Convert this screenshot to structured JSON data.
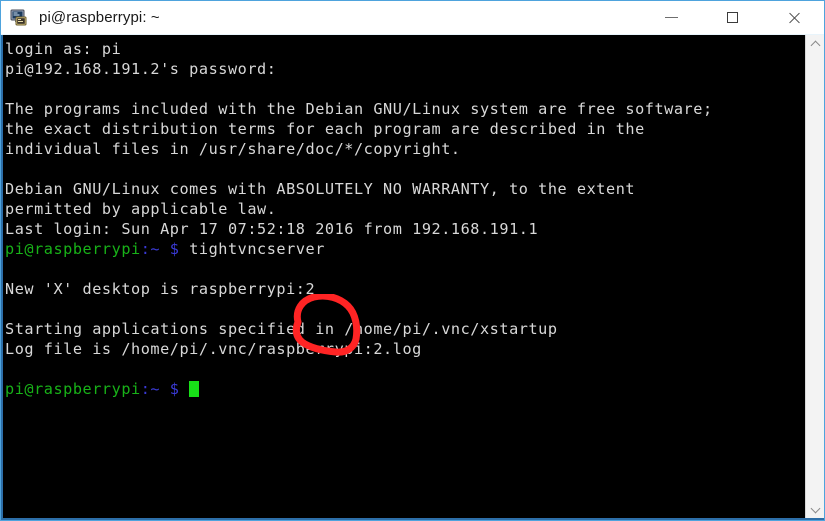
{
  "window": {
    "title": "pi@raspberrypi: ~",
    "icon": "putty-terminal-icon",
    "border_color": "#2c6ea8",
    "titlebar_bg": "#ffffff",
    "controls": {
      "minimize_label": "Minimize",
      "maximize_label": "Maximize",
      "close_label": "Close"
    }
  },
  "terminal": {
    "background": "#000000",
    "foreground": "#d8d8d8",
    "prompt_user_color": "#18b218",
    "prompt_path_color": "#3a3ad6",
    "cursor_color": "#18e018",
    "font_size_px": 15,
    "lines": [
      {
        "segments": [
          {
            "text": "login as: pi",
            "color": "white"
          }
        ]
      },
      {
        "segments": [
          {
            "text": "pi@192.168.191.2's password:",
            "color": "white"
          }
        ]
      },
      {
        "segments": [
          {
            "text": "",
            "color": "white"
          }
        ]
      },
      {
        "segments": [
          {
            "text": "The programs included with the Debian GNU/Linux system are free software;",
            "color": "white"
          }
        ]
      },
      {
        "segments": [
          {
            "text": "the exact distribution terms for each program are described in the",
            "color": "white"
          }
        ]
      },
      {
        "segments": [
          {
            "text": "individual files in /usr/share/doc/*/copyright.",
            "color": "white"
          }
        ]
      },
      {
        "segments": [
          {
            "text": "",
            "color": "white"
          }
        ]
      },
      {
        "segments": [
          {
            "text": "Debian GNU/Linux comes with ABSOLUTELY NO WARRANTY, to the extent",
            "color": "white"
          }
        ]
      },
      {
        "segments": [
          {
            "text": "permitted by applicable law.",
            "color": "white"
          }
        ]
      },
      {
        "segments": [
          {
            "text": "Last login: Sun Apr 17 07:52:18 2016 from 192.168.191.1",
            "color": "white"
          }
        ]
      },
      {
        "segments": [
          {
            "text": "pi@raspberrypi",
            "color": "green"
          },
          {
            "text": ":~ $ ",
            "color": "blue"
          },
          {
            "text": "tightvncserver",
            "color": "white"
          }
        ]
      },
      {
        "segments": [
          {
            "text": "",
            "color": "white"
          }
        ]
      },
      {
        "segments": [
          {
            "text": "New 'X' desktop is raspberrypi:2",
            "color": "white"
          }
        ]
      },
      {
        "segments": [
          {
            "text": "",
            "color": "white"
          }
        ]
      },
      {
        "segments": [
          {
            "text": "Starting applications specified in /home/pi/.vnc/xstartup",
            "color": "white"
          }
        ]
      },
      {
        "segments": [
          {
            "text": "Log file is /home/pi/.vnc/raspberrypi:2.log",
            "color": "white"
          }
        ]
      },
      {
        "segments": [
          {
            "text": "",
            "color": "white"
          }
        ]
      },
      {
        "segments": [
          {
            "text": "pi@raspberrypi",
            "color": "green"
          },
          {
            "text": ":~ $ ",
            "color": "blue"
          },
          {
            "text": "",
            "color": "white",
            "cursor": true
          }
        ]
      }
    ]
  },
  "annotation": {
    "kind": "hand-drawn-red-circle",
    "color": "#ff2424",
    "highlights_text": ":2",
    "on_line": "New 'X' desktop is raspberrypi:2"
  },
  "scrollbar": {
    "up_arrow_label": "Scroll up",
    "down_arrow_label": "Scroll down",
    "track_color": "#f3f3f3"
  }
}
